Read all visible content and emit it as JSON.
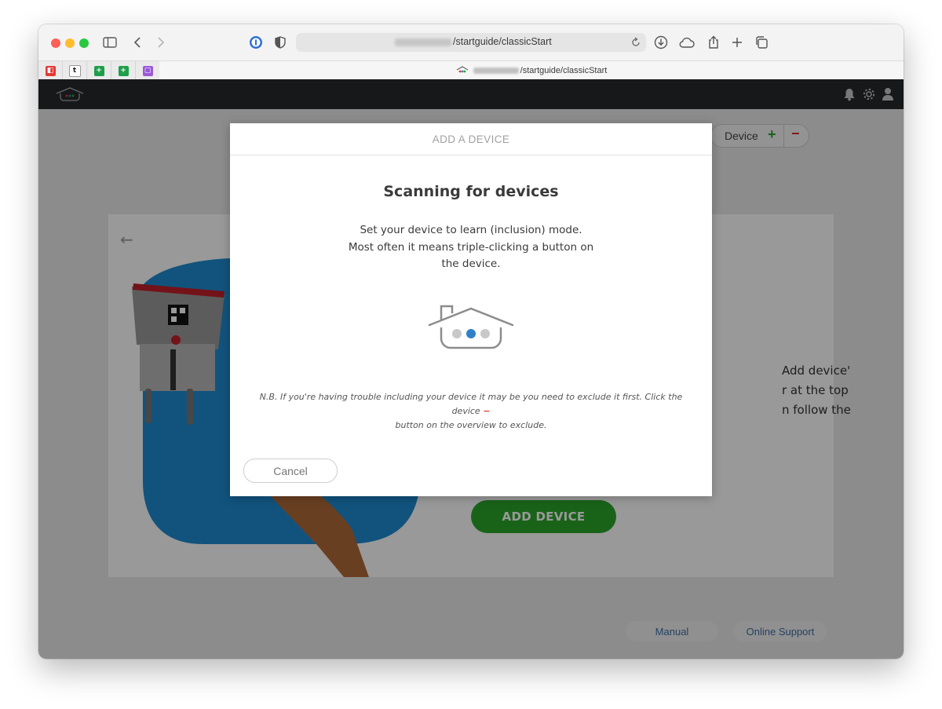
{
  "browser": {
    "url_visible": "/startguide/classicStart",
    "tab_title_visible": "/startguide/classicStart",
    "pinned_tabs": [
      {
        "icon": "red-app-icon",
        "color": "#e53935"
      },
      {
        "icon": "t-app-icon",
        "color": "#222222"
      },
      {
        "icon": "green-sheet-icon",
        "color": "#1e9e4a"
      },
      {
        "icon": "green-sheet-icon",
        "color": "#1e9e4a"
      },
      {
        "icon": "purple-app-icon",
        "color": "#9b59d6"
      }
    ]
  },
  "background": {
    "device_button_label": "Device",
    "plus_symbol": "+",
    "minus_symbol": "−",
    "card_text_lines": [
      "Add device'",
      "r at the top",
      "n follow the"
    ],
    "add_device_label": "ADD DEVICE",
    "footer": {
      "manual": "Manual",
      "support": "Online Support"
    }
  },
  "modal": {
    "header": "ADD A DEVICE",
    "title": "Scanning for devices",
    "description_lines": [
      "Set your device to learn (inclusion) mode.",
      "Most often it means triple-clicking a button on",
      "the device."
    ],
    "note_part1": "N.B. If you're having trouble including your device it may be you need to exclude it first. Click the device",
    "note_minus": "−",
    "note_part2": "button on the overview to exclude.",
    "cancel_label": "Cancel"
  },
  "colors": {
    "accent_green": "#2aa52a",
    "minus_red": "#e53935",
    "header_dark": "#25282c",
    "dot_active": "#2f80c8",
    "dot_inactive": "#c8c8c8"
  }
}
